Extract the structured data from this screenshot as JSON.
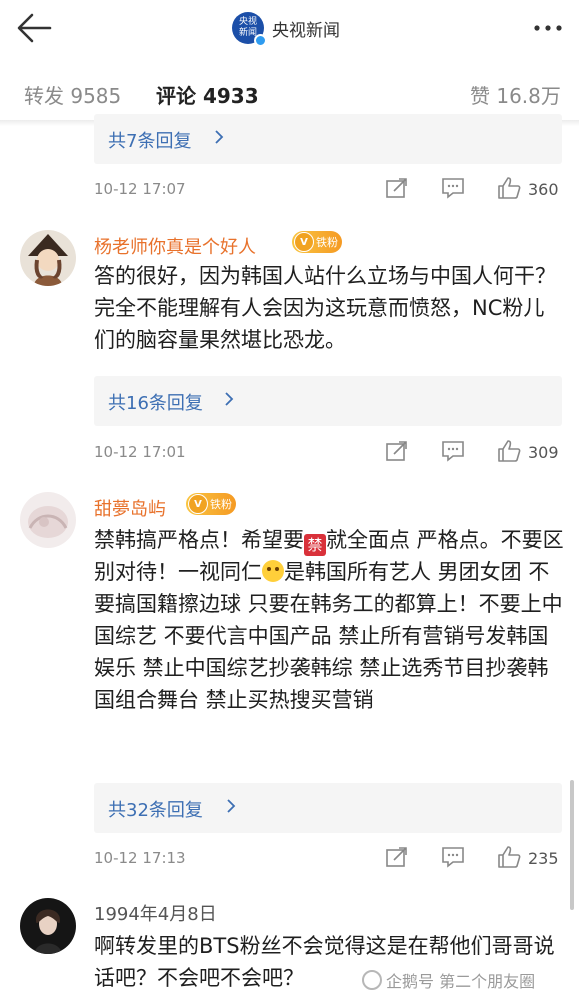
{
  "header": {
    "back_icon": "back-arrow-icon",
    "logo_text": "央视新闻",
    "account_name": "央视新闻",
    "more_icon": "more-dots-icon"
  },
  "tabs": [
    {
      "label": "转发 9585"
    },
    {
      "label": "评论 4933"
    },
    {
      "label": "赞 16.8万"
    }
  ],
  "colors": {
    "accent": "#ff8200",
    "link": "#3d6fb3",
    "username": "#e8722c"
  },
  "comments": [
    {
      "replies": "共7条回复",
      "time": "10-12 17:07",
      "likes": "360"
    },
    {
      "user": "杨老师你真是个好人",
      "badge": "铁粉",
      "text": "答的很好，因为韩国人站什么立场与中国人何干？完全不能理解有人会因为这玩意而愤怒，NC粉儿们的脑容量果然堪比恐龙。",
      "replies": "共16条回复",
      "time": "10-12 17:01",
      "likes": "309"
    },
    {
      "user": "甜夢岛屿",
      "badge": "铁粉",
      "text_a": "禁韩搞严格点！希望要",
      "emoji_ban": "禁",
      "text_b": "就全面点 严格点。不要区别对待！一视同仁",
      "text_c": "是韩国所有艺人 男团女团 不要搞国籍擦边球 只要在韩务工的都算上！不要上中国综艺 不要代言中国产品 禁止所有营销号发韩国娱乐 禁止中国综艺抄袭韩综 禁止选秀节目抄袭韩国组合舞台 禁止买热搜买营销",
      "replies": "共32条回复",
      "time": "10-12 17:13",
      "likes": "235"
    },
    {
      "user": "1994年4月8日",
      "text": "啊转发里的BTS粉丝不会觉得这是在帮他们哥哥说话吧？不会吧不会吧？"
    }
  ],
  "watermark": "企鹅号 第二个朋友圈"
}
